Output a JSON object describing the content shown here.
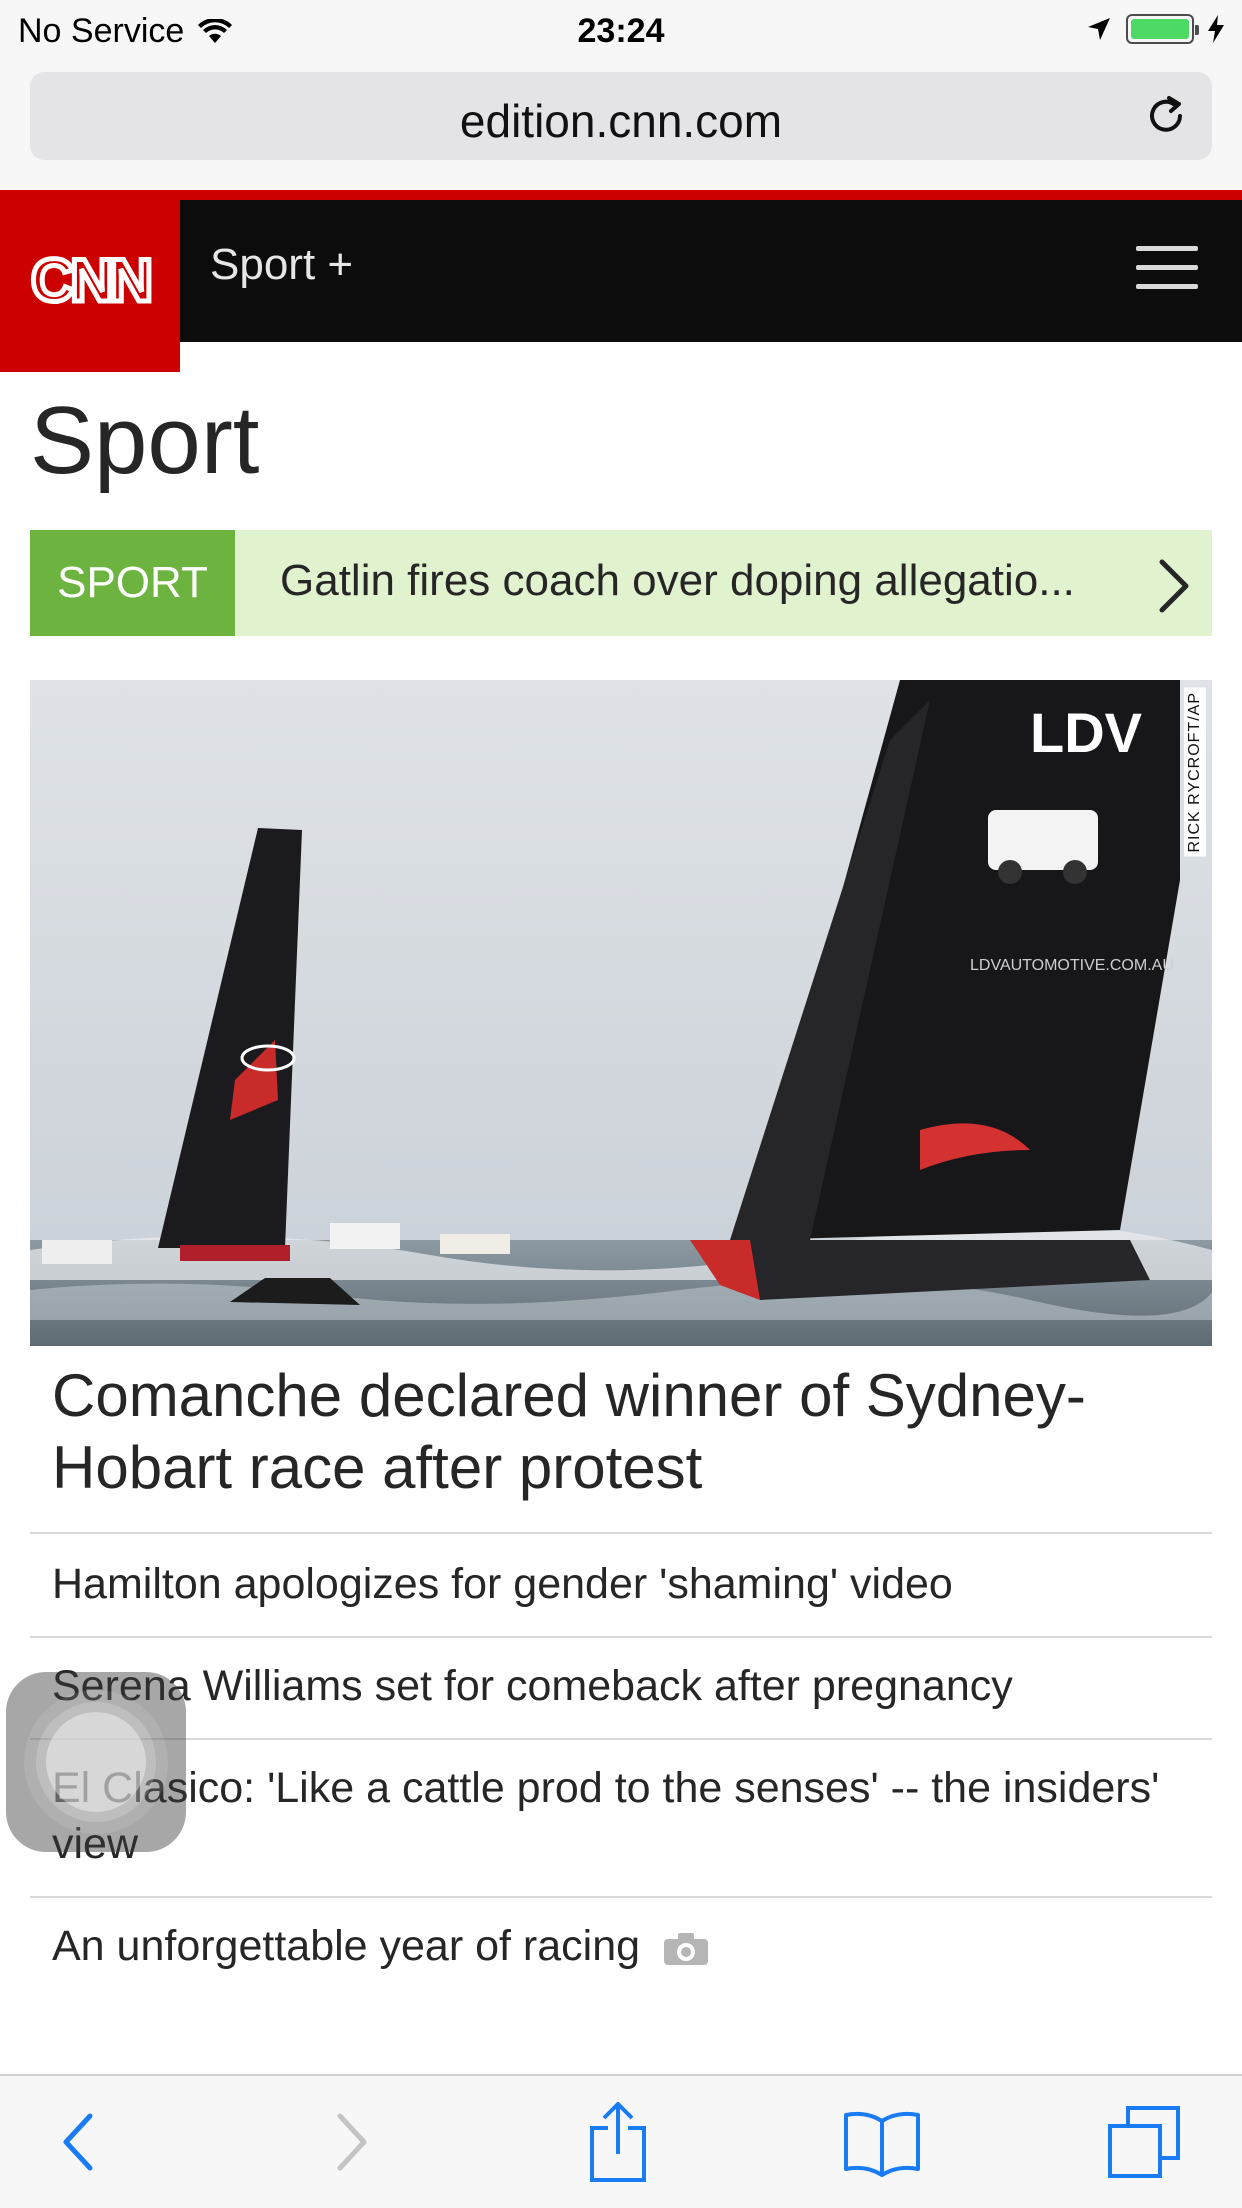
{
  "status_bar": {
    "carrier": "No Service",
    "time": "23:24"
  },
  "browser": {
    "url": "edition.cnn.com"
  },
  "header": {
    "logo": "CNN",
    "section_link": "Sport +",
    "accent_color": "#cc0000"
  },
  "page": {
    "title": "Sport"
  },
  "ticker": {
    "tag": "SPORT",
    "text": "Gatlin fires coach over doping allegatio...",
    "tag_color": "#6cb33f"
  },
  "hero": {
    "photo_credit": "RICK RYCROFT/AP",
    "boat_sail_text": "LDV",
    "boat_sail_url": "LDVAUTOMOTIVE.COM.AU",
    "headline": "Comanche declared winner of Sydney-Hobart race after protest"
  },
  "stories": [
    {
      "title": "Hamilton apologizes for gender 'shaming' video"
    },
    {
      "title": "Serena Williams set for comeback after pregnancy"
    },
    {
      "title": "El Clasico: 'Like a cattle prod to the senses' -- the insiders' view"
    },
    {
      "title": "An unforgettable year of racing",
      "icon": "camera-icon"
    }
  ],
  "toolbar": {
    "icons": [
      "back-icon",
      "forward-icon",
      "share-icon",
      "bookmarks-icon",
      "tabs-icon"
    ]
  }
}
